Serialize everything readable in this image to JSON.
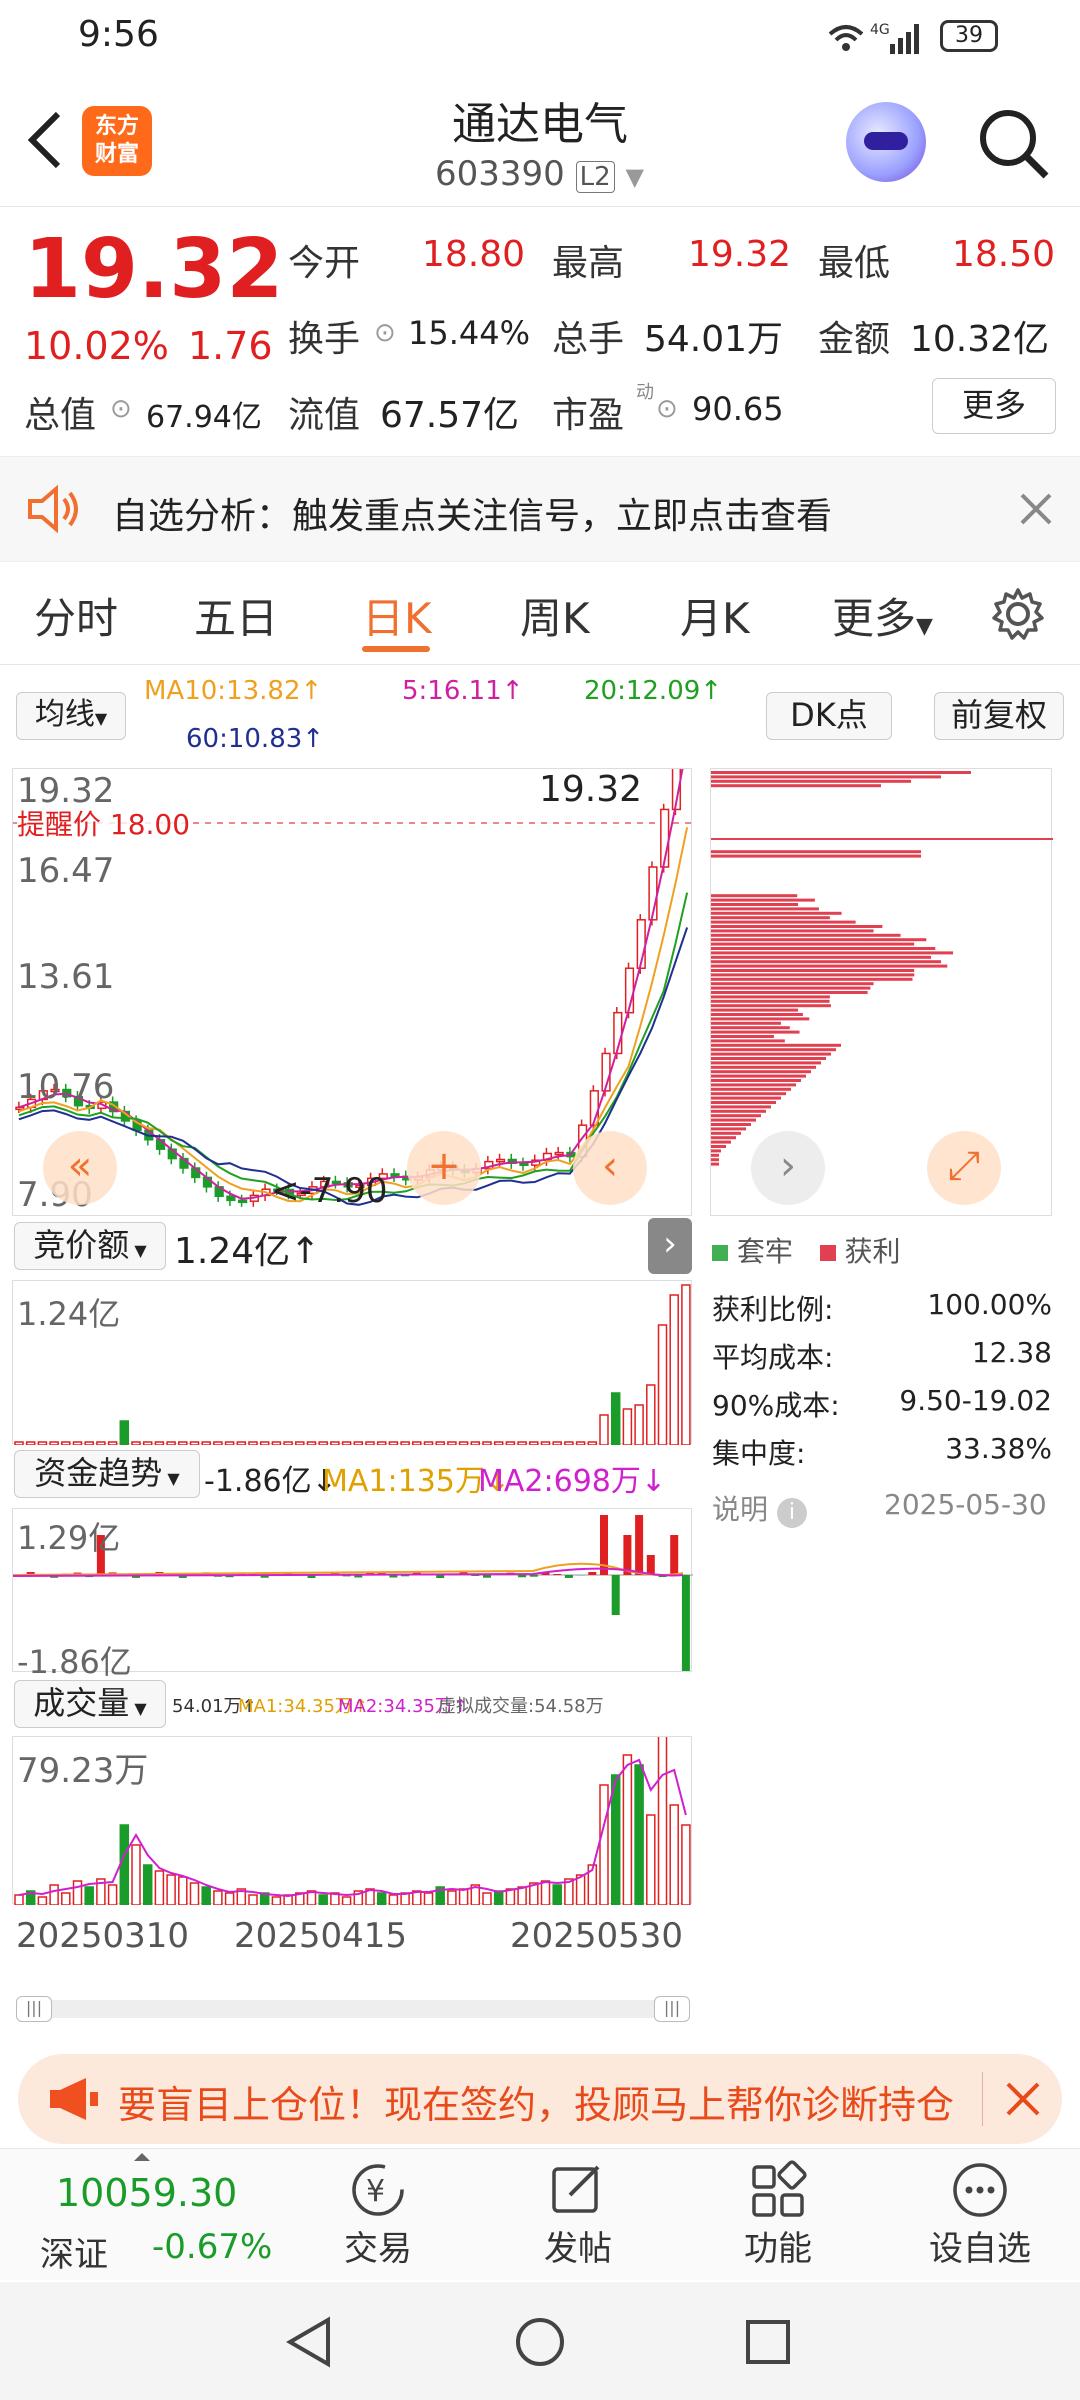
{
  "status": {
    "time": "9:56",
    "network": "4G",
    "battery": "39"
  },
  "header": {
    "title": "通达电气",
    "code": "603390",
    "level": "L2",
    "logo_line1": "东方",
    "logo_line2": "财富"
  },
  "quote": {
    "price": "19.32",
    "change_pct": "10.02%",
    "change": "1.76",
    "open_label": "今开",
    "open": "18.80",
    "high_label": "最高",
    "high": "19.32",
    "low_label": "最低",
    "low": "18.50",
    "turnover_label": "换手",
    "turnover": "15.44%",
    "volume_label": "总手",
    "volume": "54.01万",
    "amount_label": "金额",
    "amount": "10.32亿",
    "mcap_label": "总值",
    "mcap": "67.94亿",
    "float_label": "流值",
    "float_cap": "67.57亿",
    "pe_label": "市盈",
    "pe_sup": "动",
    "pe": "90.65",
    "more": "更多"
  },
  "banner": {
    "text": "自选分析：触发重点关注信号，立即点击查看"
  },
  "tabs": [
    "分时",
    "五日",
    "日K",
    "周K",
    "月K",
    "更多"
  ],
  "ma_bar": {
    "selector": "均线",
    "ma10": "MA10:13.82↑",
    "ma5": "5:16.11↑",
    "ma20": "20:12.09↑",
    "ma60": "60:10.83↑",
    "dk": "DK点",
    "adjust": "前复权",
    "color_ma10": "#f0a020",
    "color_ma5": "#d020a0",
    "color_ma20": "#20a020",
    "color_ma60": "#203090"
  },
  "kchart": {
    "y_top": "19.32",
    "y2": "16.47",
    "y3": "13.61",
    "y4": "10.76",
    "y_bottom": "7.90",
    "alert": "提醒价 18.00",
    "high_marker": "19.32",
    "low_marker": "<-7.90"
  },
  "auction": {
    "selector": "竞价额",
    "value": "1.24亿↑",
    "ymax": "1.24亿"
  },
  "fund": {
    "selector": "资金趋势",
    "value": "-1.86亿↓",
    "ma1": "MA1:135万↓",
    "ma2": "MA2:698万↓",
    "ymax": "1.29亿",
    "ymin": "-1.86亿"
  },
  "vol": {
    "selector": "成交量",
    "value": "54.01万↑",
    "ma1": "MA1:34.35万↑",
    "ma2": "MA2:34.35万↑",
    "virtual": "虚拟成交量:54.58万",
    "ymax": "79.23万"
  },
  "dates": [
    "20250310",
    "20250415",
    "20250530"
  ],
  "chips": {
    "legend1": "套牢",
    "legend2": "获利",
    "rows": [
      {
        "label": "获利比例:",
        "value": "100.00%"
      },
      {
        "label": "平均成本:",
        "value": "12.38"
      },
      {
        "label": "90%成本:",
        "value": "9.50-19.02"
      },
      {
        "label": "集中度:",
        "value": "33.38%"
      }
    ],
    "note": "说明",
    "date": "2025-05-30"
  },
  "ad": {
    "text": "要盲目上仓位！现在签约，投顾马上帮你诊断持仓"
  },
  "bottom": {
    "index_value": "10059.30",
    "index_name": "深证",
    "index_change": "-0.67%",
    "items": [
      "交易",
      "发帖",
      "功能",
      "设自选"
    ]
  }
}
